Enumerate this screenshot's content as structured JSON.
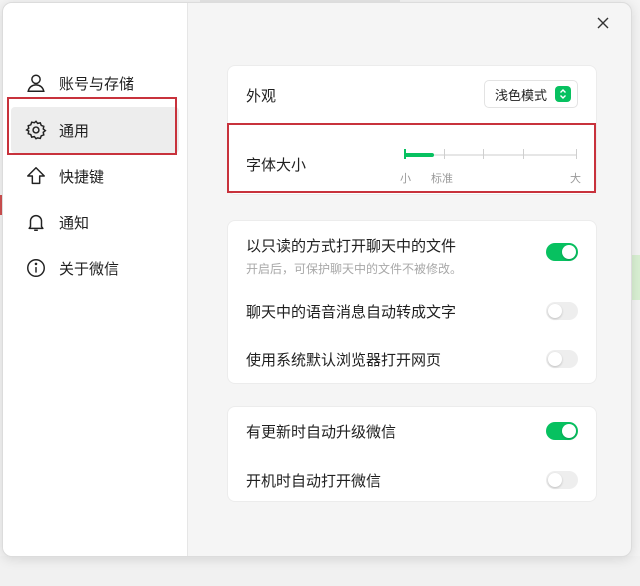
{
  "colors": {
    "accent": "#07c160",
    "highlight": "#c8323c"
  },
  "sidebar": {
    "items": [
      {
        "label": "账号与存储",
        "icon": "user-icon",
        "active": false
      },
      {
        "label": "通用",
        "icon": "gear-icon",
        "active": true
      },
      {
        "label": "快捷键",
        "icon": "shortcut-arrow-icon",
        "active": false
      },
      {
        "label": "通知",
        "icon": "bell-icon",
        "active": false
      },
      {
        "label": "关于微信",
        "icon": "info-icon",
        "active": false
      }
    ]
  },
  "general": {
    "appearance": {
      "label": "外观",
      "value": "浅色模式"
    },
    "font_size": {
      "label": "字体大小",
      "small_label": "小",
      "standard_label": "标准",
      "large_label": "大",
      "level": 0
    },
    "read_only": {
      "label": "以只读的方式打开聊天中的文件",
      "desc": "开启后，可保护聊天中的文件不被修改。",
      "on": true
    },
    "voice_to_text": {
      "label": "聊天中的语音消息自动转成文字",
      "on": false
    },
    "default_browser": {
      "label": "使用系统默认浏览器打开网页",
      "on": false
    },
    "auto_update": {
      "label": "有更新时自动升级微信",
      "on": true
    },
    "auto_start": {
      "label": "开机时自动打开微信",
      "on": false
    }
  }
}
